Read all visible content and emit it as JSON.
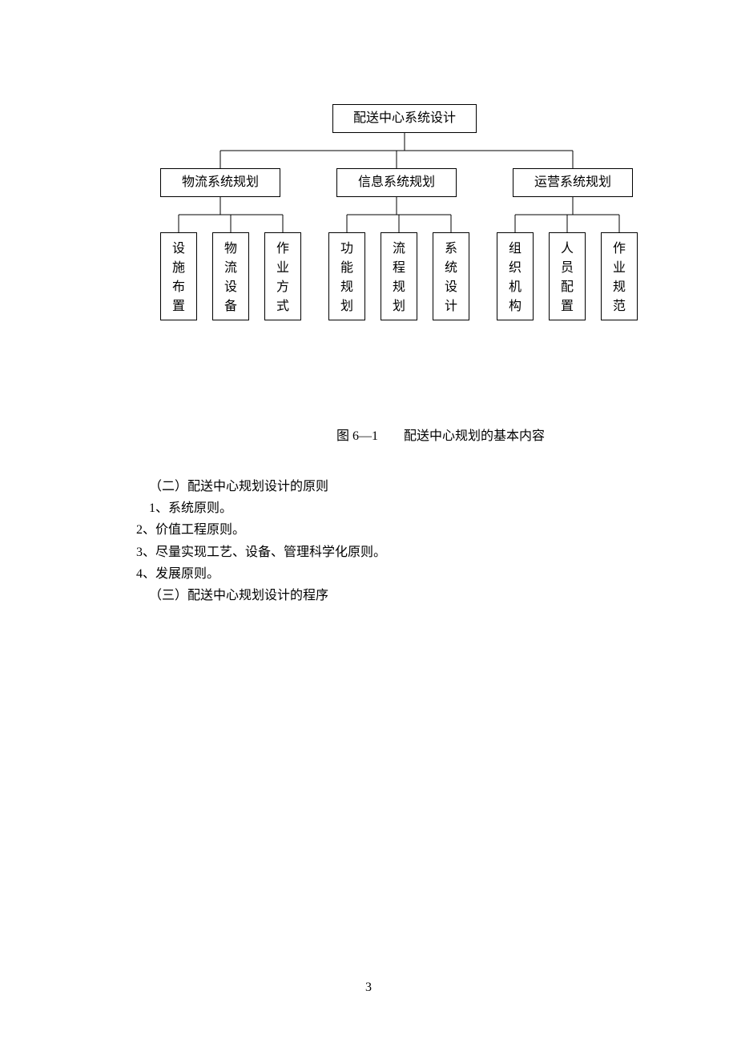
{
  "chart_data": {
    "type": "tree",
    "root": "配送中心系统设计",
    "children": [
      {
        "name": "物流系统规划",
        "children": [
          "设施布置",
          "物流设备",
          "作业方式"
        ]
      },
      {
        "name": "信息系统规划",
        "children": [
          "功能规划",
          "流程规划",
          "系统设计"
        ]
      },
      {
        "name": "运营系统规划",
        "children": [
          "组织机构",
          "人员配置",
          "作业规范"
        ]
      }
    ]
  },
  "diagram": {
    "root": "配送中心系统设计",
    "mid": [
      "物流系统规划",
      "信息系统规划",
      "运营系统规划"
    ],
    "leaves": [
      "设施布置",
      "物流设备",
      "作业方式",
      "功能规划",
      "流程规划",
      "系统设计",
      "组织机构",
      "人员配置",
      "作业规范"
    ]
  },
  "caption": "图 6—1　　配送中心规划的基本内容",
  "section": {
    "heading2": "（二）配送中心规划设计的原则",
    "item1": "1、系统原则。",
    "item2": "2、价值工程原则。",
    "item3": "3、尽量实现工艺、设备、管理科学化原则。",
    "item4": "4、发展原则。",
    "heading3": "（三）配送中心规划设计的程序"
  },
  "page": "3"
}
